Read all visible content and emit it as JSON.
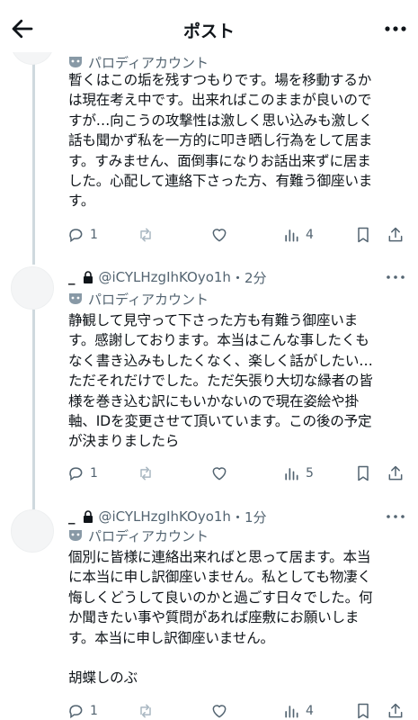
{
  "header": {
    "title": "ポスト"
  },
  "posts": [
    {
      "badge": "パロディアカウント",
      "lines": [
        "暫くはこの垢を残すつもりです。場を移動するか",
        "は現在考え中です。出来ればこのままが良いので",
        "すが…向こうの攻撃性は激しく思い込みも激しく",
        "話も聞かず私を一方的に叩き晒し行為をして居ま",
        "す。すみません、面倒事になりお話出来ずに居ま",
        "した。心配して連絡下さった方、有難う御座いま",
        "す。"
      ],
      "replies": "1",
      "reposts": "",
      "likes": "",
      "views": "4"
    },
    {
      "display_name": "_",
      "handle": "@iCYLHzgIhKOyo1h",
      "time": "・2分",
      "badge": "パロディアカウント",
      "lines": [
        "静観して見守って下さった方も有難う御座いま",
        "す。感謝しております。本当はこんな事したくも",
        "なく書き込みもしたくなく、楽しく話がしたい…",
        "ただそれだけでした。ただ矢張り大切な縁者の皆",
        "様を巻き込む訳にもいかないので現在姿絵や掛",
        "軸、IDを変更させて頂いています。この後の予定",
        "が決まりましたら"
      ],
      "replies": "1",
      "reposts": "",
      "likes": "",
      "views": "5"
    },
    {
      "display_name": "_",
      "handle": "@iCYLHzgIhKOyo1h",
      "time": "・1分",
      "badge": "パロディアカウント",
      "lines": [
        "個別に皆様に連絡出来ればと思って居ます。本当",
        "に本当に申し訳御座いません。私としても物凄く",
        "悔しくどうして良いのかと過ごす日々でした。何",
        "か聞きたい事や質問があれば座敷にお願いしま",
        "す。本当に申し訳御座いません。",
        "",
        "胡蝶しのぶ"
      ],
      "replies": "1",
      "reposts": "",
      "likes": "",
      "views": "4"
    }
  ]
}
